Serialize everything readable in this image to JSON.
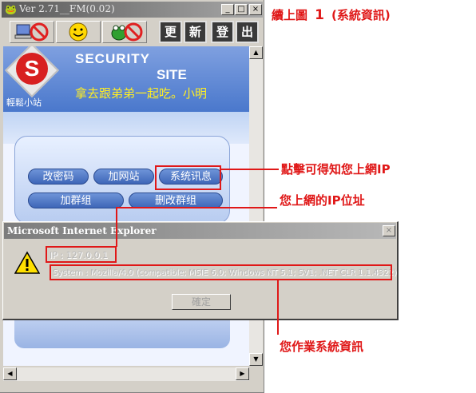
{
  "window": {
    "title": "Ver 2.71__FM(0.02)",
    "title_icon": "frog-icon",
    "controls": [
      "_",
      "□",
      "×"
    ]
  },
  "toolbar": {
    "icons": [
      "computer-no-icon",
      "smiley-icon",
      "frog-no-icon"
    ],
    "buttons": [
      "更",
      "新",
      "登",
      "出"
    ]
  },
  "banner": {
    "security": "SECURITY",
    "site": "SITE",
    "subtitle": "輕鬆小站",
    "marquee": "拿去跟弟弟一起吃。小明"
  },
  "menu": {
    "change_password": "改密码",
    "add_site": "加网站",
    "system_info": "系统讯息",
    "add_group": "加群组",
    "edit_group": "删改群组"
  },
  "dialog": {
    "title": "Microsoft Internet Explorer",
    "close": "×",
    "ip": "IP : 127.0.0.1",
    "system": "System : Mozilla/4.0 (compatible; MSIE 6.0; Windows NT 5.1; SV1; .NET CLR 1.1.4322)",
    "ok_label": "確定"
  },
  "annotations": {
    "heading_prefix": "續上圖",
    "heading_number": "1",
    "heading_suffix": "(系統資訊)",
    "click_note": "點擊可得知您上網IP",
    "ip_note": "您上網的IP位址",
    "os_note": "您作業系統資訊"
  },
  "colors": {
    "annotation_red": "#e01818",
    "banner_blue": "#4a78cc",
    "marquee_yellow": "#ffee22"
  }
}
